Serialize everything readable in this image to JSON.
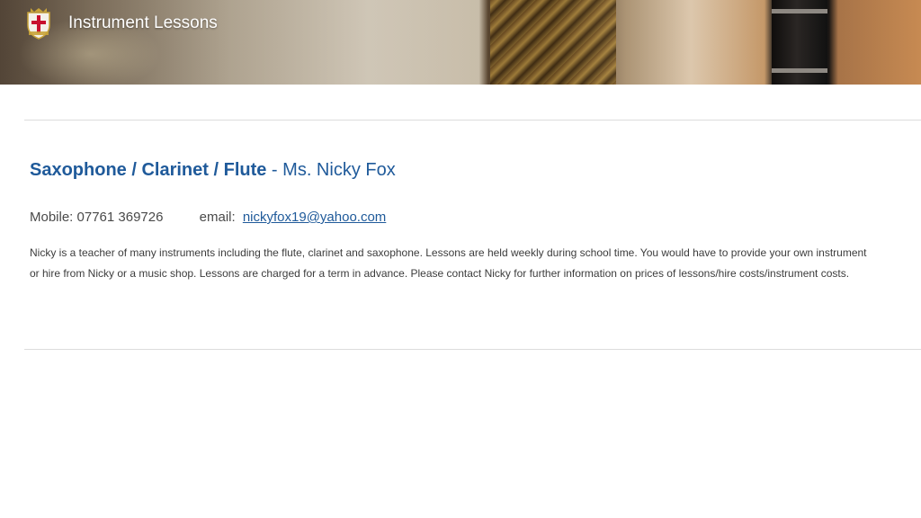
{
  "header": {
    "title": "Instrument Lessons",
    "crest_icon": "school-crest-icon"
  },
  "lesson": {
    "instruments": "Saxophone / Clarinet / Flute",
    "separator": " - ",
    "teacher": "Ms. Nicky Fox",
    "mobile_label": "Mobile: 07761 369726",
    "email_label": "email:",
    "email": "nickyfox19@yahoo.com",
    "description": "Nicky is a teacher of many instruments including the flute, clarinet and saxophone. Lessons are held weekly during school time.  You would have to provide your own instrument or hire from Nicky or a music shop.  Lessons are charged for a term in advance.  Please contact Nicky  for further information on prices of lessons/hire costs/instrument costs."
  },
  "colors": {
    "heading": "#1f5a9a",
    "body_text": "#3c3c3c",
    "divider": "#dcdcdc"
  }
}
